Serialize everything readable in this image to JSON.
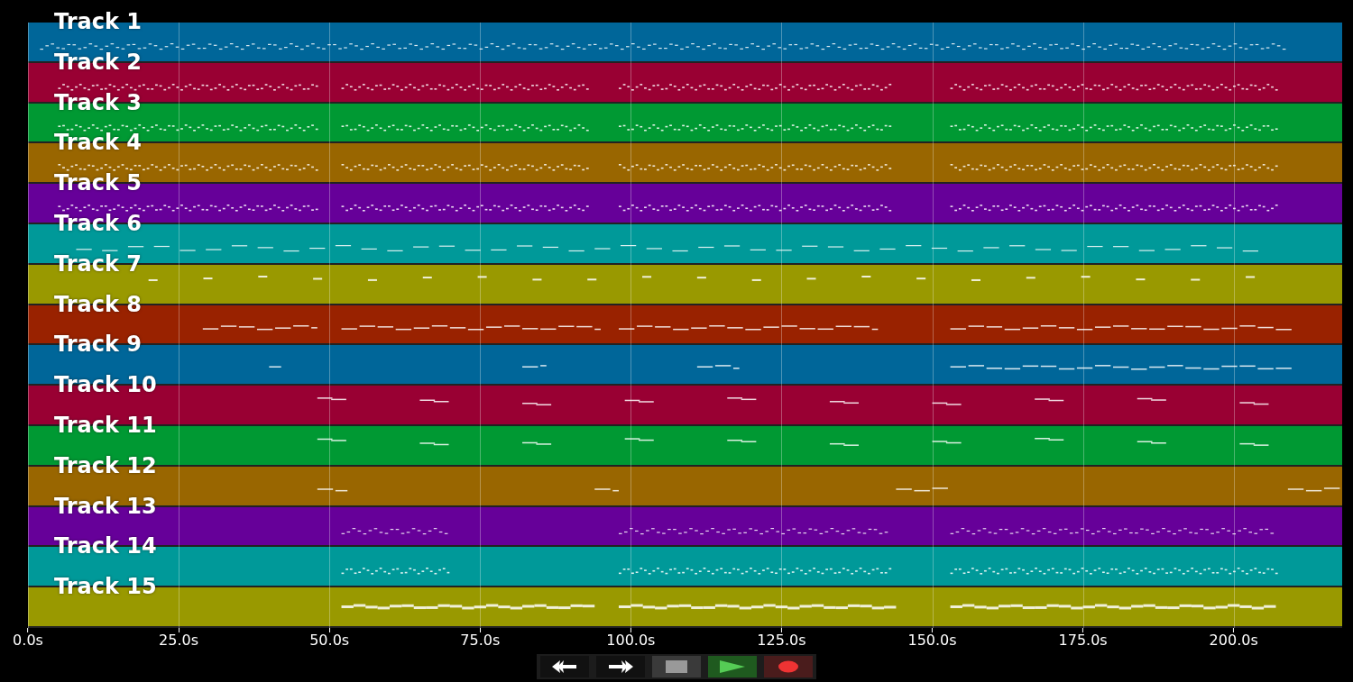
{
  "tracks": [
    {
      "label": "Track 1",
      "color": "#006699"
    },
    {
      "label": "Track 2",
      "color": "#990033"
    },
    {
      "label": "Track 3",
      "color": "#009933"
    },
    {
      "label": "Track 4",
      "color": "#996600"
    },
    {
      "label": "Track 5",
      "color": "#660099"
    },
    {
      "label": "Track 6",
      "color": "#009999"
    },
    {
      "label": "Track 7",
      "color": "#999900"
    },
    {
      "label": "Track 8",
      "color": "#992200"
    },
    {
      "label": "Track 9",
      "color": "#006699"
    },
    {
      "label": "Track 10",
      "color": "#990033"
    },
    {
      "label": "Track 11",
      "color": "#009933"
    },
    {
      "label": "Track 12",
      "color": "#996600"
    },
    {
      "label": "Track 13",
      "color": "#660099"
    },
    {
      "label": "Track 14",
      "color": "#009999"
    },
    {
      "label": "Track 15",
      "color": "#999900"
    }
  ],
  "axis": {
    "ticks": [
      "0.0s",
      "25.0s",
      "50.0s",
      "75.0s",
      "100.0s",
      "125.0s",
      "150.0s",
      "175.0s",
      "200.0s"
    ]
  },
  "controls": [
    {
      "kind": "rewind"
    },
    {
      "kind": "forward"
    },
    {
      "kind": "stop"
    },
    {
      "kind": "play"
    },
    {
      "kind": "record"
    }
  ]
}
